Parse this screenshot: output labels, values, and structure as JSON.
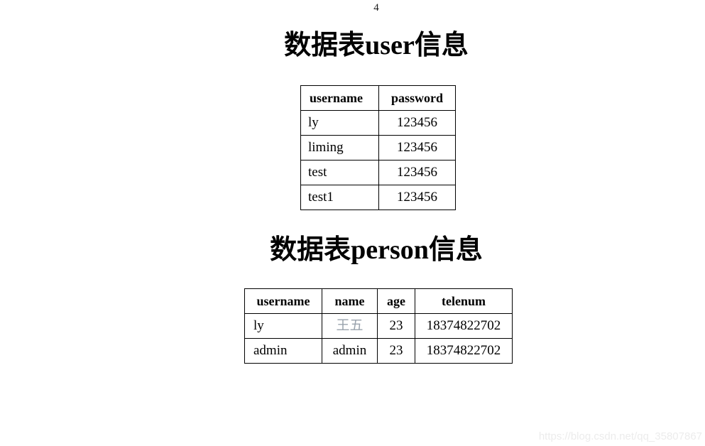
{
  "page": {
    "number": "4",
    "background_color": "#ffffff",
    "text_color": "#000000"
  },
  "sections": [
    {
      "title": "数据表user信息",
      "table": {
        "name": "user",
        "columns": [
          "username",
          "password"
        ],
        "rows": [
          [
            "ly",
            "123456"
          ],
          [
            "liming",
            "123456"
          ],
          [
            "test",
            "123456"
          ],
          [
            "test1",
            "123456"
          ]
        ]
      }
    },
    {
      "title": "数据表person信息",
      "table": {
        "name": "person",
        "columns": [
          "username",
          "name",
          "age",
          "telenum"
        ],
        "rows": [
          [
            "ly",
            "王五",
            "23",
            "18374822702"
          ],
          [
            "admin",
            "admin",
            "23",
            "18374822702"
          ]
        ]
      }
    }
  ],
  "watermark": {
    "text": "https://blog.csdn.net/qq_35807867",
    "color": "#ececec"
  }
}
